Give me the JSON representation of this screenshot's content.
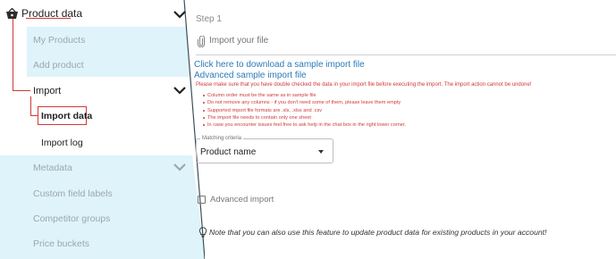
{
  "sidebar": {
    "product_data": {
      "label": "Product data"
    },
    "my_products": {
      "label": "My Products"
    },
    "add_product": {
      "label": "Add product"
    },
    "import": {
      "label": "Import"
    },
    "import_data": {
      "label": "Import data"
    },
    "import_log": {
      "label": "Import log"
    },
    "metadata": {
      "label": "Metadata"
    },
    "custom_field_labels": {
      "label": "Custom field labels"
    },
    "competitor_groups": {
      "label": "Competitor groups"
    },
    "price_buckets": {
      "label": "Price buckets"
    }
  },
  "main": {
    "step_label": "Step 1",
    "upload_placeholder": "Import your file",
    "download_link": "Click here to download a sample import file",
    "advanced_link": "Advanced sample import file",
    "warning": "Please make sure that you have double checked the data in your import file before executing the import. The import action cannot be undone!",
    "rules": [
      "Column order must be the same as in sample file",
      "Do not remove any columns - if you don't need some of them, please leave them empty",
      "Supported import file formats are .xls, .xlsx and .csv",
      "The import file needs to contain only one sheet",
      "In case you encounter issues feel free to ask help in the chat box in the right lower corner."
    ],
    "matching_legend": "Matching criteria",
    "matching_value": "Product name",
    "advanced_import_label": "Advanced import",
    "note": "Note that you can also use this feature to update product data for existing products in your account!"
  },
  "colors": {
    "sidebar_highlight": "#dff3fb",
    "accent_red": "#d0393b",
    "link_blue": "#2b7bb9"
  }
}
